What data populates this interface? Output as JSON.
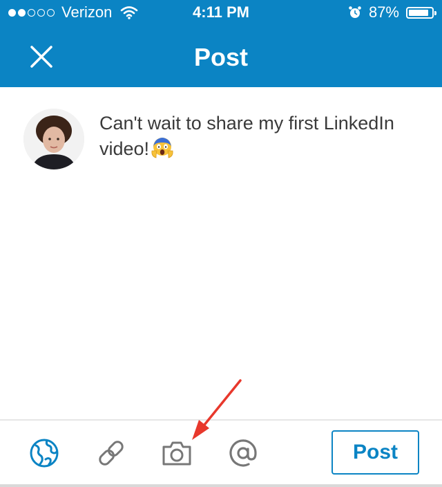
{
  "status_bar": {
    "signal_strength": "2 of 5",
    "carrier": "Verizon",
    "time": "4:11 PM",
    "battery_percent": "87%",
    "battery_level": 0.87,
    "icons": [
      "wifi-icon",
      "alarm-icon",
      "battery-icon"
    ]
  },
  "header": {
    "title": "Post",
    "close_icon": "close-icon",
    "background_color": "#0b84c4"
  },
  "composer": {
    "text": "Can't wait to share my first LinkedIn video!",
    "emoji": "😱",
    "avatar": "avatar"
  },
  "toolbar": {
    "icons": [
      "globe-icon",
      "link-icon",
      "camera-icon",
      "mention-icon"
    ],
    "post_label": "Post",
    "accent_color": "#0b84c4",
    "icon_color": "#777777"
  },
  "annotation": {
    "arrow_color": "#e8382c",
    "points_to": "camera-icon"
  }
}
